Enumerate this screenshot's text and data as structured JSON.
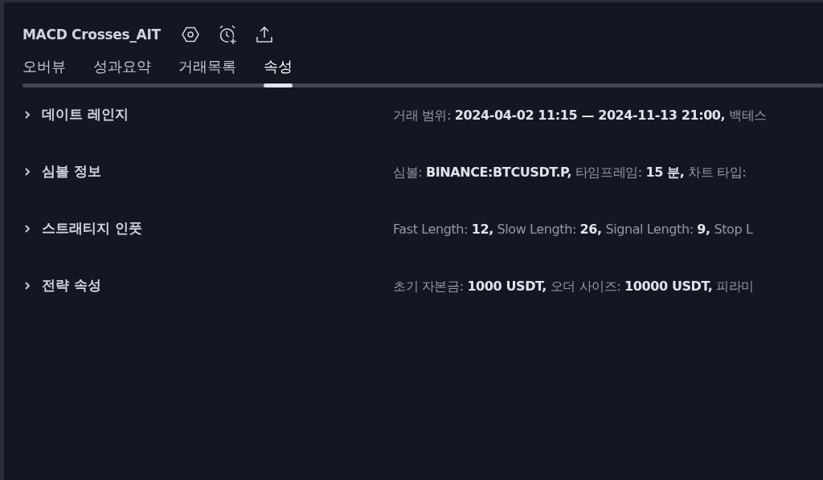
{
  "title": "MACD Crosses_AIT",
  "tabs": [
    {
      "label": "오버뷰",
      "selected": false
    },
    {
      "label": "성과요약",
      "selected": false
    },
    {
      "label": "거래목록",
      "selected": false
    },
    {
      "label": "속성",
      "selected": true
    }
  ],
  "sections": [
    {
      "title": "데이트 레인지",
      "expanded": false,
      "summary": "거래 범위: **2024-04-02 11:15 — 2024-11-13 21:00,** 백테스"
    },
    {
      "title": "심볼 정보",
      "expanded": false,
      "summary": "심볼: **BINANCE:BTCUSDT.P,** 타임프레임: **15 분,** 차트 타입:"
    },
    {
      "title": "스트래티지 인풋",
      "expanded": false,
      "summary": "Fast Length: **12,** Slow Length: **26,** Signal Length: **9,** Stop L"
    },
    {
      "title": "전략 속성",
      "expanded": false,
      "summary": "초기 자본금: **1000 USDT,** 오더 사이즈: **10000 USDT,** 피라미"
    }
  ]
}
